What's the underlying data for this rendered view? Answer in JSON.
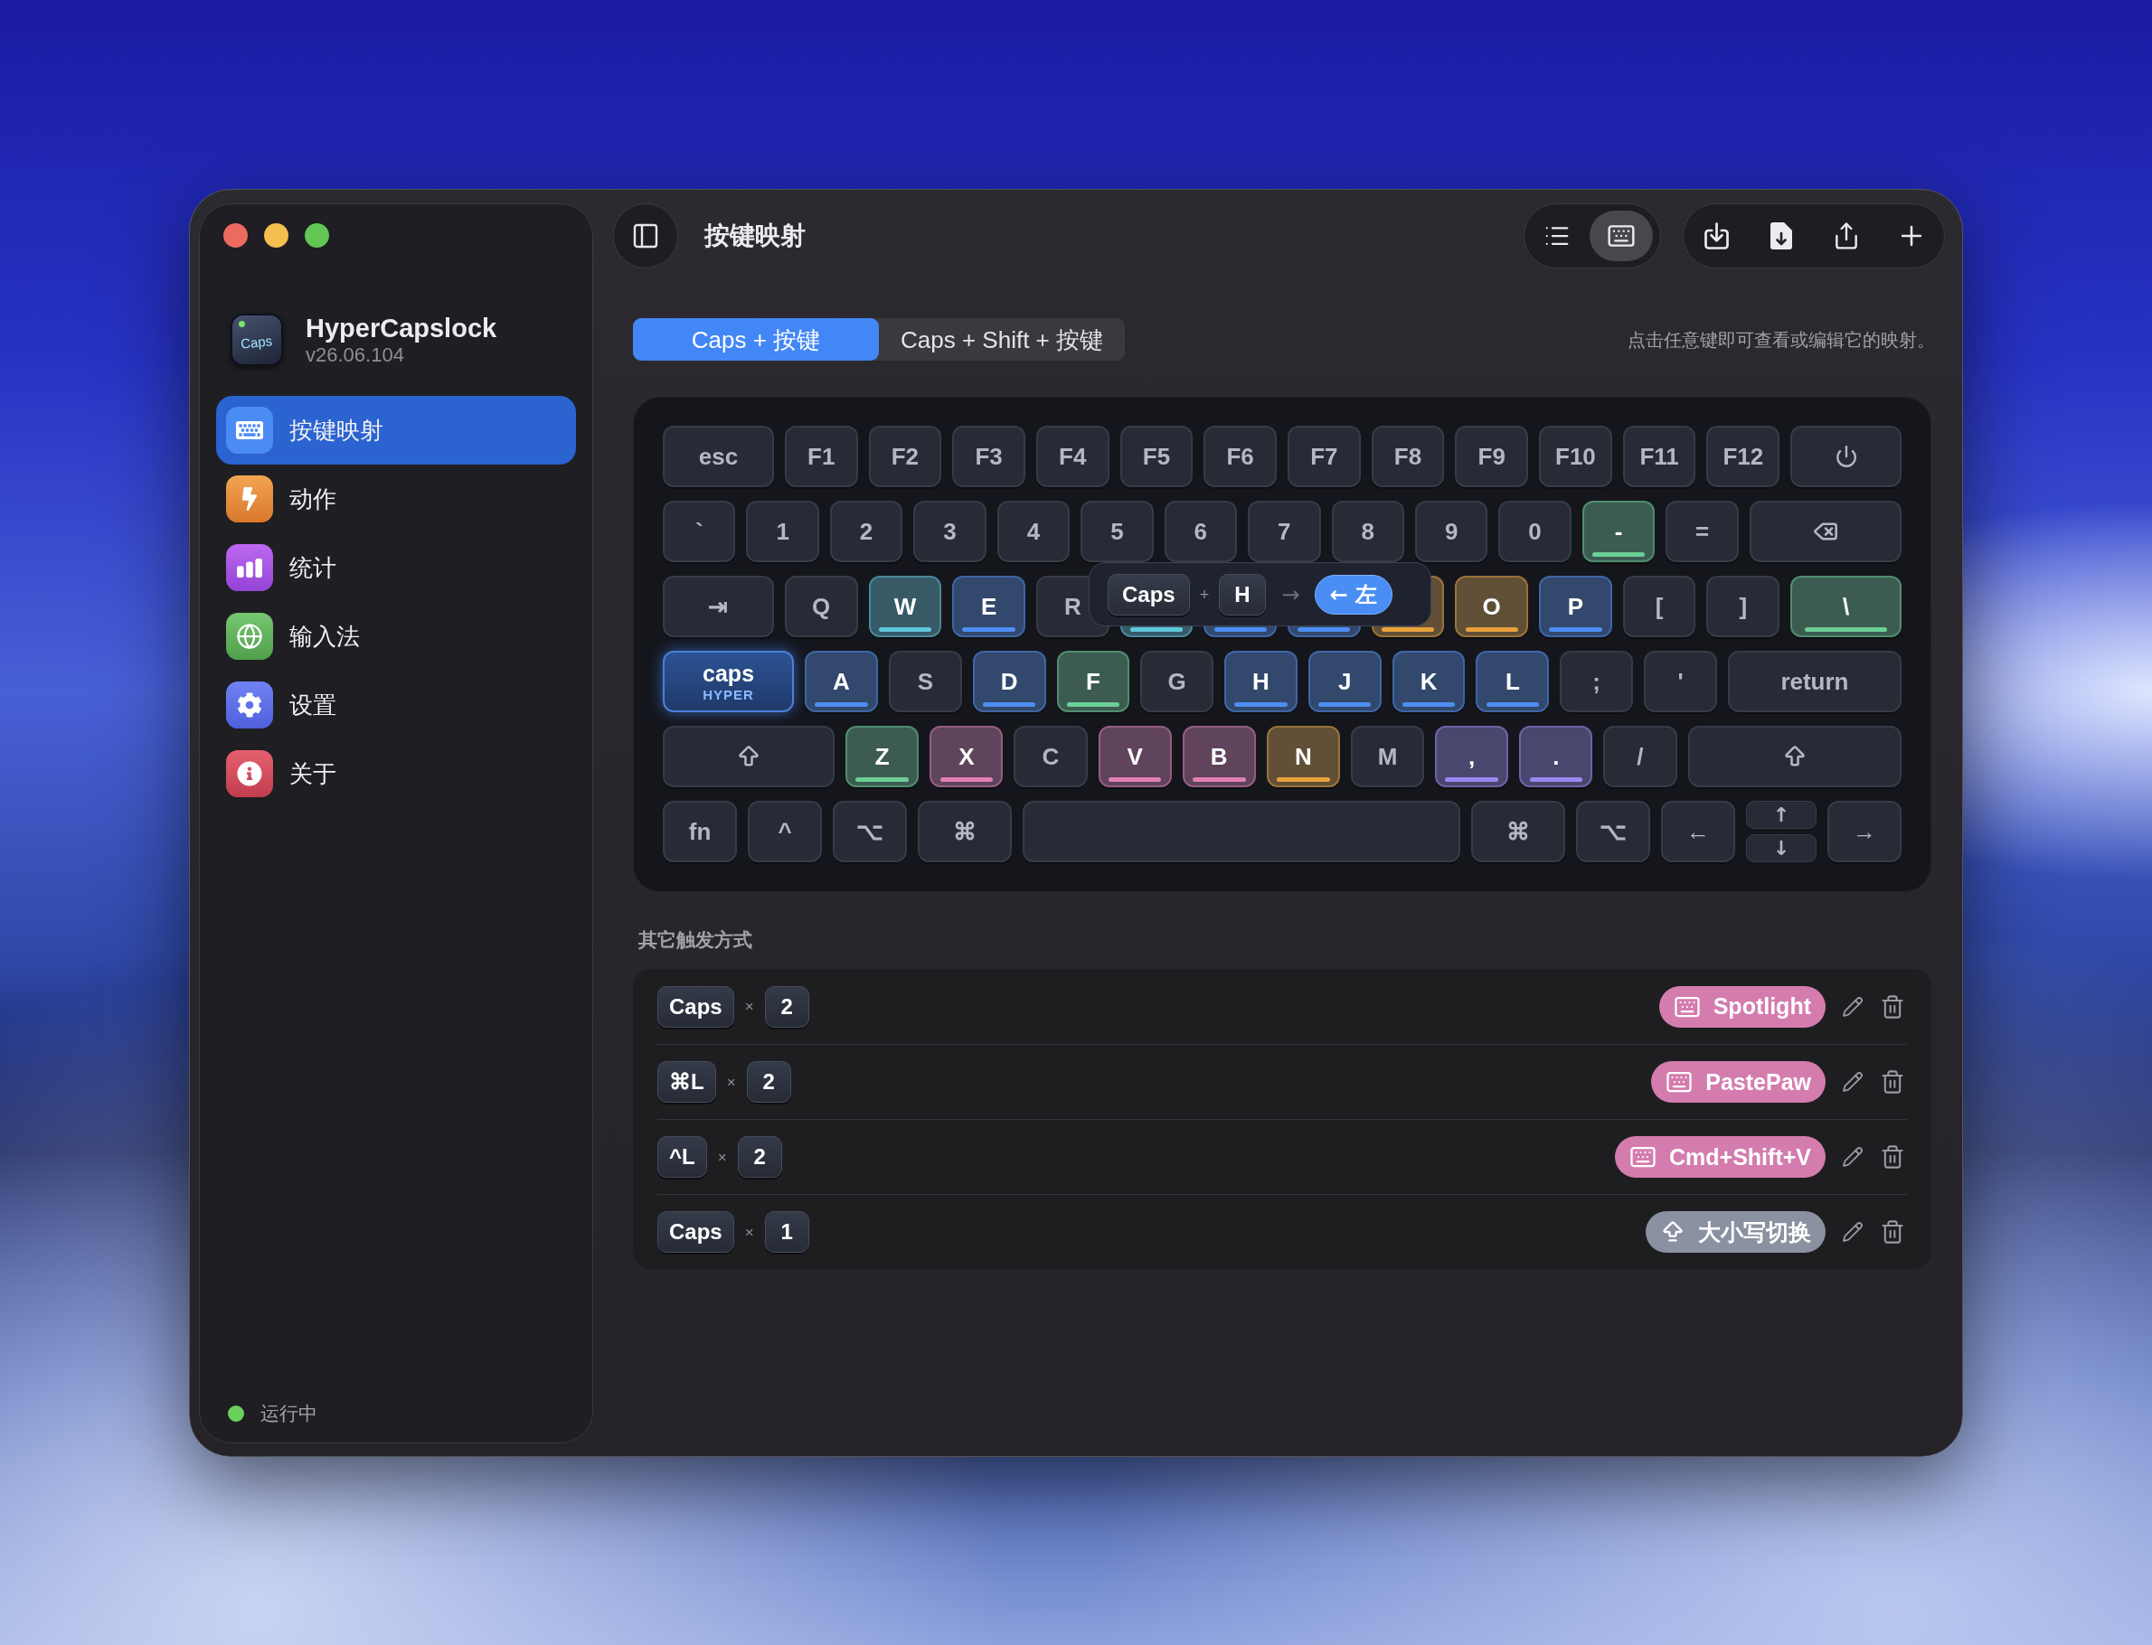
{
  "sidebar": {
    "app": {
      "icon_text": "Caps",
      "name": "HyperCapslock",
      "version": "v26.06.104"
    },
    "items": [
      {
        "label": "按键映射",
        "selected": true
      },
      {
        "label": "动作",
        "selected": false
      },
      {
        "label": "统计",
        "selected": false
      },
      {
        "label": "输入法",
        "selected": false
      },
      {
        "label": "设置",
        "selected": false
      },
      {
        "label": "关于",
        "selected": false
      }
    ],
    "status": {
      "label": "运行中",
      "active": true
    }
  },
  "toolbar": {
    "title": "按键映射",
    "view_modes": [
      {
        "selected": false
      },
      {
        "selected": true
      }
    ]
  },
  "tabs": [
    {
      "label": "Caps + 按键",
      "selected": true
    },
    {
      "label": "Caps + Shift + 按键",
      "selected": false
    }
  ],
  "hint": "点击任意键即可查看或编辑它的映射。",
  "keyboard": {
    "rows": [
      {
        "keys": [
          {
            "kind": "key",
            "label": "esc"
          },
          {
            "kind": "key",
            "label": "F1"
          },
          {
            "kind": "key",
            "label": "F2"
          },
          {
            "kind": "key",
            "label": "F3"
          },
          {
            "kind": "key",
            "label": "F4"
          },
          {
            "kind": "key",
            "label": "F5"
          },
          {
            "kind": "key",
            "label": "F6"
          },
          {
            "kind": "key",
            "label": "F7"
          },
          {
            "kind": "key",
            "label": "F8"
          },
          {
            "kind": "key",
            "label": "F9"
          },
          {
            "kind": "key",
            "label": "F10"
          },
          {
            "kind": "key",
            "label": "F11"
          },
          {
            "kind": "key",
            "label": "F12"
          },
          {
            "kind": "power"
          }
        ]
      },
      {
        "keys": [
          {
            "kind": "key",
            "label": "`"
          },
          {
            "kind": "key",
            "label": "1"
          },
          {
            "kind": "key",
            "label": "2"
          },
          {
            "kind": "key",
            "label": "3"
          },
          {
            "kind": "key",
            "label": "4"
          },
          {
            "kind": "key",
            "label": "5"
          },
          {
            "kind": "key",
            "label": "6"
          },
          {
            "kind": "key",
            "label": "7"
          },
          {
            "kind": "key",
            "label": "8"
          },
          {
            "kind": "key",
            "label": "9"
          },
          {
            "kind": "key",
            "label": "0"
          },
          {
            "kind": "key",
            "label": "-",
            "color": "#6ccf96"
          },
          {
            "kind": "key",
            "label": "="
          },
          {
            "kind": "delete"
          }
        ]
      },
      {
        "keys": [
          {
            "kind": "key",
            "label": "⇥"
          },
          {
            "kind": "key",
            "label": "Q"
          },
          {
            "kind": "key",
            "label": "W",
            "color": "#5ec8dc"
          },
          {
            "kind": "key",
            "label": "E",
            "color": "#4d8df0"
          },
          {
            "kind": "key",
            "label": "R"
          },
          {
            "kind": "key",
            "color": "#5ec8dc"
          },
          {
            "kind": "key",
            "color": "#4d8df0"
          },
          {
            "kind": "key",
            "color": "#4d8df0"
          },
          {
            "kind": "key",
            "color": "#e8a23c"
          },
          {
            "kind": "key",
            "label": "O",
            "color": "#e8a23c"
          },
          {
            "kind": "key",
            "label": "P",
            "color": "#4d8df0"
          },
          {
            "kind": "key",
            "label": "["
          },
          {
            "kind": "key",
            "label": "]"
          },
          {
            "kind": "key",
            "label": "\\",
            "color": "#6ccf96"
          }
        ]
      },
      {
        "keys": [
          {
            "kind": "hyper",
            "label": "caps",
            "sub": "HYPER"
          },
          {
            "kind": "key",
            "label": "A",
            "color": "#4d8df0"
          },
          {
            "kind": "key",
            "label": "S"
          },
          {
            "kind": "key",
            "label": "D",
            "color": "#4d8df0"
          },
          {
            "kind": "key",
            "label": "F",
            "color": "#6ccf96"
          },
          {
            "kind": "key",
            "label": "G"
          },
          {
            "kind": "key",
            "label": "H",
            "color": "#4d8df0"
          },
          {
            "kind": "key",
            "label": "J",
            "color": "#4d8df0"
          },
          {
            "kind": "key",
            "label": "K",
            "color": "#4d8df0"
          },
          {
            "kind": "key",
            "label": "L",
            "color": "#4d8df0"
          },
          {
            "kind": "key",
            "label": ";"
          },
          {
            "kind": "key",
            "label": "'"
          },
          {
            "kind": "key",
            "label": "return"
          }
        ]
      },
      {
        "keys": [
          {
            "kind": "shift"
          },
          {
            "kind": "key",
            "label": "Z",
            "color": "#6ccf96"
          },
          {
            "kind": "key",
            "label": "X",
            "color": "#e27fb4"
          },
          {
            "kind": "key",
            "label": "C"
          },
          {
            "kind": "key",
            "label": "V",
            "color": "#e27fb4"
          },
          {
            "kind": "key",
            "label": "B",
            "color": "#e27fb4"
          },
          {
            "kind": "key",
            "label": "N",
            "color": "#e8a23c"
          },
          {
            "kind": "key",
            "label": "M"
          },
          {
            "kind": "key",
            "label": ",",
            "color": "#9c88f2"
          },
          {
            "kind": "key",
            "label": ".",
            "color": "#9c88f2"
          },
          {
            "kind": "key",
            "label": "/"
          },
          {
            "kind": "shift"
          }
        ]
      },
      {
        "keys": [
          {
            "kind": "key",
            "label": "fn"
          },
          {
            "kind": "key",
            "label": "^"
          },
          {
            "kind": "key",
            "label": "⌥"
          },
          {
            "kind": "key",
            "label": "⌘"
          },
          {
            "kind": "space"
          },
          {
            "kind": "key",
            "label": "⌘"
          },
          {
            "kind": "key",
            "label": "⌥"
          },
          {
            "kind": "key",
            "label": "←"
          },
          {
            "kind": "split",
            "top": "↑",
            "bottom": "↓"
          },
          {
            "kind": "key",
            "label": "→"
          }
        ]
      }
    ],
    "popover": {
      "trigger": "Caps",
      "plus": "+",
      "key": "H",
      "arrow": "→",
      "result": "← 左"
    }
  },
  "other_triggers": {
    "title": "其它触发方式",
    "rows": [
      {
        "key": "Caps",
        "times": "×",
        "count": "2",
        "action": {
          "kind": "keystroke",
          "label": "Spotlight",
          "color": "#d47cae"
        }
      },
      {
        "key": "⌘L",
        "times": "×",
        "count": "2",
        "action": {
          "kind": "keystroke",
          "label": "PastePaw",
          "color": "#d47cae"
        }
      },
      {
        "key": "^L",
        "times": "×",
        "count": "2",
        "action": {
          "kind": "keystroke",
          "label": "Cmd+Shift+V",
          "color": "#d47cae"
        }
      },
      {
        "key": "Caps",
        "times": "×",
        "count": "1",
        "action": {
          "kind": "capslock",
          "label": "大小写切换",
          "color": "#8a91a0"
        }
      }
    ]
  }
}
